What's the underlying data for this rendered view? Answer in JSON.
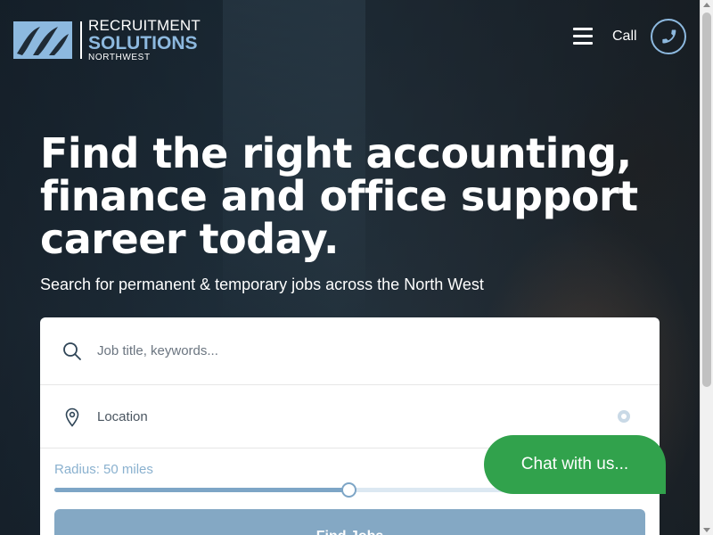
{
  "brand": {
    "line1": "RECRUITMENT",
    "line2": "SOLUTIONS",
    "line3": "NORTHWEST",
    "accent_color": "#8db9df"
  },
  "nav": {
    "menu_icon": "hamburger-icon",
    "call_label": "Call",
    "call_icon": "phone-icon"
  },
  "hero": {
    "headline": "Find the right accounting, finance and office support career today.",
    "subheadline": "Search for permanent & temporary jobs across the North West"
  },
  "search": {
    "keywords_placeholder": "Job title, keywords...",
    "keywords_icon": "search-icon",
    "location_placeholder": "Location",
    "location_icon": "map-pin-icon",
    "radius_label": "Radius: 50 miles",
    "radius_fraction": 0.5,
    "find_button_label": "Find Jobs",
    "button_color": "#84a8c4"
  },
  "chat": {
    "label": "Chat with us...",
    "color": "#31a24c"
  }
}
